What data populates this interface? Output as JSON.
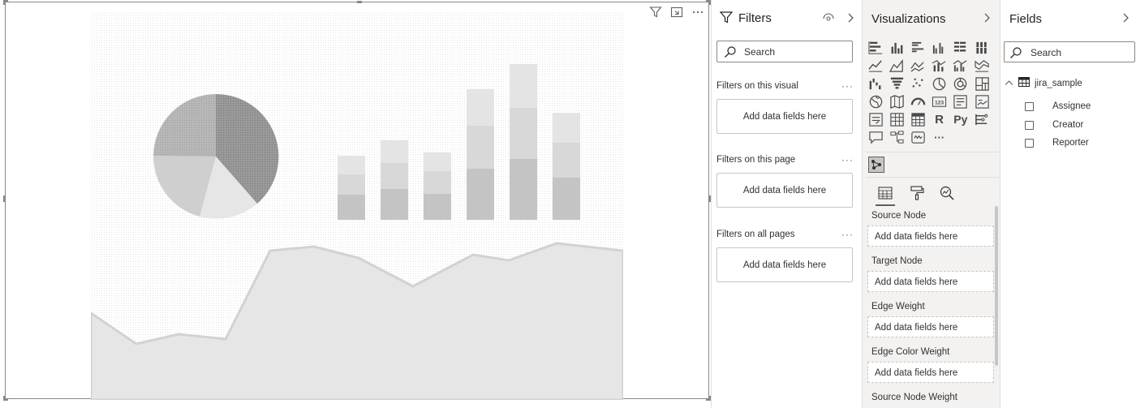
{
  "filters": {
    "title": "Filters",
    "search_placeholder": "Search",
    "sections": [
      {
        "label": "Filters on this visual",
        "more": "···",
        "well": "Add data fields here"
      },
      {
        "label": "Filters on this page",
        "more": "···",
        "well": "Add data fields here"
      },
      {
        "label": "Filters on all pages",
        "more": "···",
        "well": "Add data fields here"
      }
    ]
  },
  "visualizations": {
    "title": "Visualizations",
    "icons": [
      "stacked-bar-icon",
      "stacked-column-icon",
      "clustered-bar-icon",
      "clustered-column-icon",
      "100-stacked-bar-icon",
      "100-stacked-column-icon",
      "line-chart-icon",
      "area-chart-icon",
      "stacked-area-icon",
      "line-column-icon",
      "line-clustered-column-icon",
      "ribbon-chart-icon",
      "waterfall-icon",
      "funnel-icon",
      "scatter-icon",
      "pie-chart-icon",
      "donut-chart-icon",
      "treemap-icon",
      "map-icon",
      "filled-map-icon",
      "gauge-icon",
      "card-icon",
      "multi-row-card-icon",
      "kpi-icon",
      "slicer-icon",
      "table-icon",
      "matrix-icon",
      "r-visual-icon",
      "python-visual-icon",
      "key-influencers-icon",
      "qa-icon",
      "decomposition-tree-icon",
      "smart-narrative-icon",
      "more-visuals-icon"
    ],
    "r_label": "R",
    "py_label": "Py",
    "more_label": "···",
    "wells": [
      {
        "label": "Source Node",
        "placeholder": "Add data fields here"
      },
      {
        "label": "Target Node",
        "placeholder": "Add data fields here"
      },
      {
        "label": "Edge Weight",
        "placeholder": "Add data fields here"
      },
      {
        "label": "Edge Color Weight",
        "placeholder": "Add data fields here"
      },
      {
        "label": "Source Node Weight"
      }
    ]
  },
  "fields": {
    "title": "Fields",
    "search_placeholder": "Search",
    "table_name": "jira_sample",
    "items": [
      "Assignee",
      "Creator",
      "Reporter"
    ]
  },
  "colors": {
    "pane_background": "#f3f2f1",
    "border": "#e1dfdd",
    "text": "#252423",
    "placeholder_light": "#e6e6e6",
    "placeholder_mid": "#c8c8c8",
    "placeholder_dark": "#9e9e9e"
  }
}
